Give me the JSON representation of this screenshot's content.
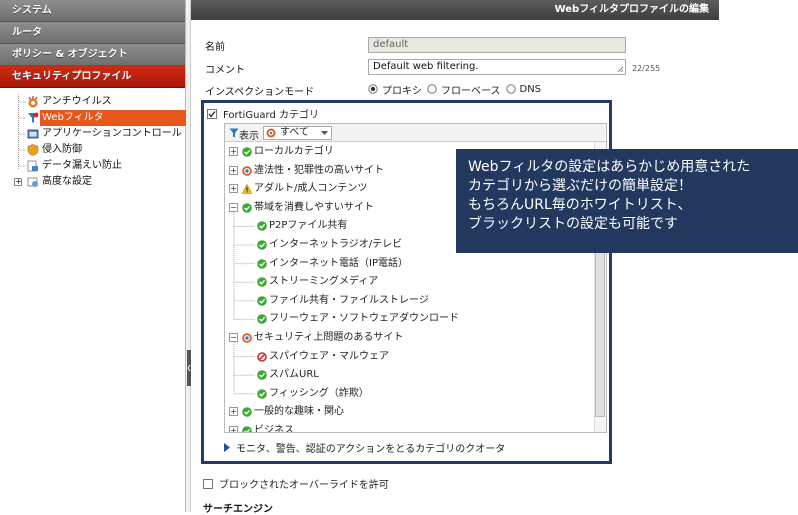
{
  "sidebar": {
    "headers": [
      {
        "label": "システム"
      },
      {
        "label": "ルータ"
      },
      {
        "label": "ポリシー & オブジェクト"
      },
      {
        "label": "セキュリティプロファイル"
      }
    ],
    "items": [
      {
        "label": "アンチウイルス",
        "icon": "antivirus-icon"
      },
      {
        "label": "Webフィルタ",
        "icon": "webfilter-icon"
      },
      {
        "label": "アプリケーションコントロール",
        "icon": "app-control-icon"
      },
      {
        "label": "侵入防御",
        "icon": "ips-shield-icon"
      },
      {
        "label": "データ漏えい防止",
        "icon": "dlp-icon"
      },
      {
        "label": "高度な設定",
        "icon": "advanced-icon"
      }
    ]
  },
  "title": "Webフィルタプロファイルの編集",
  "form": {
    "name_label": "名前",
    "name_value": "default",
    "comment_label": "コメント",
    "comment_value": "Default web filtering.",
    "comment_count": "22/255",
    "inspection_label": "インスペクションモード",
    "modes": [
      "プロキシ",
      "フローベース",
      "DNS"
    ],
    "selected_mode": "プロキシ"
  },
  "fortiguard": {
    "label": "FortiGuard カテゴリ",
    "toolbar_label": "表示",
    "filter_value": "すべて",
    "categories": [
      {
        "label": "ローカルカテゴリ",
        "status": "allow",
        "level": 0,
        "expand": "+"
      },
      {
        "label": "違法性・犯罪性の高いサイト",
        "status": "mixed",
        "level": 0,
        "expand": "+"
      },
      {
        "label": "アダルト/成人コンテンツ",
        "status": "warning",
        "level": 0,
        "expand": "+"
      },
      {
        "label": "帯域を消費しやすいサイト",
        "status": "allow",
        "level": 0,
        "expand": "−"
      },
      {
        "label": "P2Pファイル共有",
        "status": "allow",
        "level": 1
      },
      {
        "label": "インターネットラジオ/テレビ",
        "status": "allow",
        "level": 1
      },
      {
        "label": "インターネット電話（IP電話）",
        "status": "allow",
        "level": 1
      },
      {
        "label": "ストリーミングメディア",
        "status": "allow",
        "level": 1
      },
      {
        "label": "ファイル共有・ファイルストレージ",
        "status": "allow",
        "level": 1
      },
      {
        "label": "フリーウェア・ソフトウェアダウンロード",
        "status": "allow",
        "level": 1
      },
      {
        "label": "セキュリティ上問題のあるサイト",
        "status": "mixed",
        "level": 0,
        "expand": "−"
      },
      {
        "label": "スパイウェア・マルウェア",
        "status": "block",
        "level": 1
      },
      {
        "label": "スパムURL",
        "status": "allow",
        "level": 1
      },
      {
        "label": "フィッシング（詐欺）",
        "status": "allow",
        "level": 1
      },
      {
        "label": "一般的な趣味・関心",
        "status": "allow",
        "level": 0,
        "expand": "+"
      },
      {
        "label": "ビジネス",
        "status": "allow",
        "level": 0,
        "expand": "+"
      }
    ],
    "quota_label": "モニタ、警告、認証のアクションをとるカテゴリのクオータ"
  },
  "override_label": "ブロックされたオーバーライドを許可",
  "search_engine_label": "サーチエンジン",
  "callout": [
    "Webフィルタの設定はあらかじめ用意された",
    "カテゴリから選ぶだけの簡単設定！",
    "もちろんURL毎のホワイトリスト、",
    "ブラックリストの設定も可能です"
  ],
  "colors": {
    "accent_red": "#c0200e",
    "selected_orange": "#e8561c",
    "callout_navy": "#22385f",
    "allow_green": "#3aaa35",
    "block_red": "#d9262b"
  }
}
